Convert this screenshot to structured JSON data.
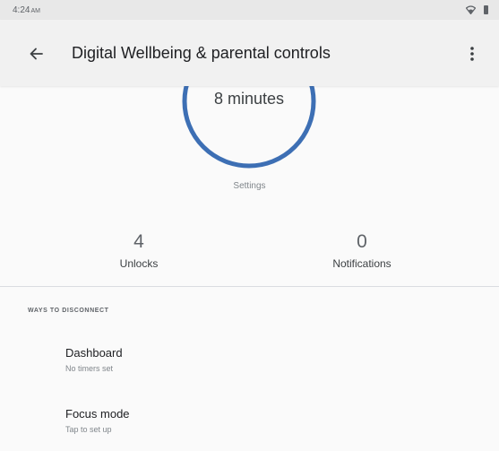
{
  "status_bar": {
    "time": "4:24",
    "ampm": "AM",
    "icons": [
      "wifi-icon",
      "battery-icon"
    ]
  },
  "app_bar": {
    "back_icon": "arrow-back-icon",
    "title": "Digital Wellbeing & parental controls",
    "overflow_icon": "more-vert-icon"
  },
  "usage": {
    "value": "8 minutes",
    "settings_link": "Settings",
    "ring_color": "#3d6fb4"
  },
  "stats": [
    {
      "value": "4",
      "label": "Unlocks"
    },
    {
      "value": "0",
      "label": "Notifications"
    }
  ],
  "ways_to_disconnect": {
    "header": "WAYS TO DISCONNECT",
    "items": [
      {
        "title": "Dashboard",
        "subtitle": "No timers set"
      },
      {
        "title": "Focus mode",
        "subtitle": "Tap to set up"
      }
    ]
  },
  "colors": {
    "status_bar_bg": "#e8e8e8",
    "app_bar_bg": "#f1f1f1",
    "page_bg": "#fafafa",
    "text_primary": "#202124",
    "text_secondary": "#80868b"
  }
}
